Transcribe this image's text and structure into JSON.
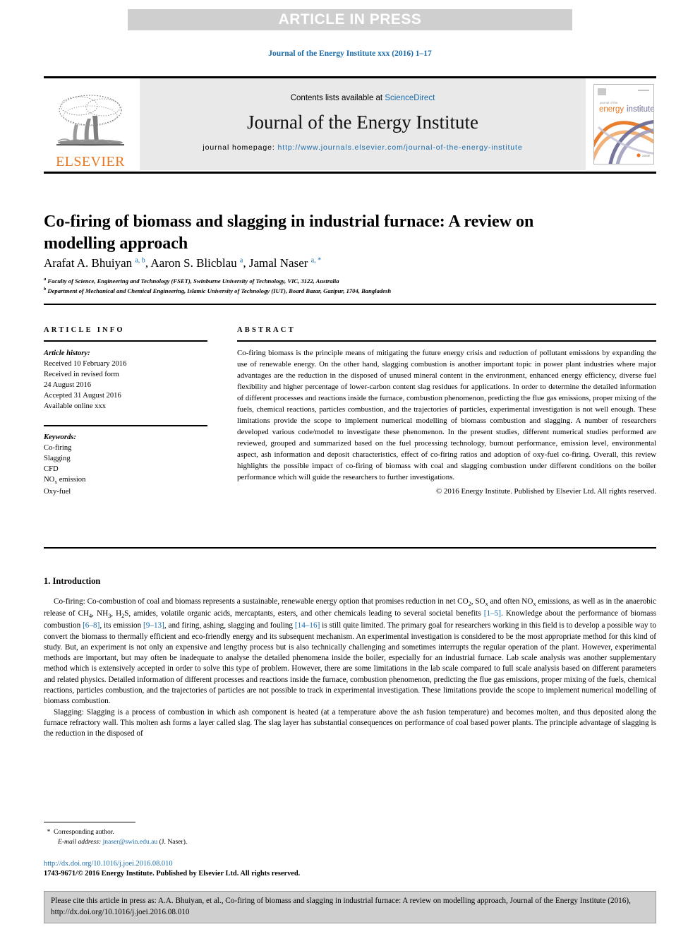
{
  "banner": {
    "label": "ARTICLE IN PRESS"
  },
  "running_head": {
    "text": "Journal of the Energy Institute xxx (2016) 1–17"
  },
  "masthead": {
    "contents_prefix": "Contents lists available at ",
    "sciencedirect": "ScienceDirect",
    "journal_title": "Journal of the Energy Institute",
    "homepage_label": "journal homepage: ",
    "homepage_url": "http://www.journals.elsevier.com/journal-of-the-energy-institute",
    "publisher_name": "ELSEVIER",
    "cover_title_small": "journal of the",
    "cover_title_main_a": "energy",
    "cover_title_main_b": "institute"
  },
  "article": {
    "title": "Co-firing of biomass and slagging in industrial furnace: A review on modelling approach",
    "authors_html": "Arafat A. Bhuiyan <sup>a, b</sup>, Aaron S. Blicblau <sup>a</sup>, Jamal Naser <sup>a, *</sup>",
    "affiliation_a": "Faculty of Science, Engineering and Technology (FSET), Swinburne University of Technology, VIC, 3122, Australia",
    "affiliation_b": "Department of Mechanical and Chemical Engineering, Islamic University of Technology (IUT), Board Bazar, Gazipur, 1704, Bangladesh"
  },
  "article_info": {
    "heading": "ARTICLE INFO",
    "history_label": "Article history:",
    "history_lines": [
      "Received 10 February 2016",
      "Received in revised form",
      "24 August 2016",
      "Accepted 31 August 2016",
      "Available online xxx"
    ],
    "keywords_label": "Keywords:",
    "keywords": [
      "Co-firing",
      "Slagging",
      "CFD",
      "NOx emission",
      "Oxy-fuel"
    ],
    "keyword_nox_base": "NO",
    "keyword_nox_sub": "x",
    "keyword_nox_rest": " emission"
  },
  "abstract": {
    "heading": "ABSTRACT",
    "text": "Co-firing biomass is the principle means of mitigating the future energy crisis and reduction of pollutant emissions by expanding the use of renewable energy. On the other hand, slagging combustion is another important topic in power plant industries where major advantages are the reduction in the disposed of unused mineral content in the environment, enhanced energy efficiency, diverse fuel flexibility and higher percentage of lower-carbon content slag residues for applications. In order to determine the detailed information of different processes and reactions inside the furnace, combustion phenomenon, predicting the flue gas emissions, proper mixing of the fuels, chemical reactions, particles combustion, and the trajectories of particles, experimental investigation is not well enough. These limitations provide the scope to implement numerical modelling of biomass combustion and slagging. A number of researchers developed various code/model to investigate these phenomenon. In the present studies, different numerical studies performed are reviewed, grouped and summarized based on the fuel processing technology, burnout performance, emission level, environmental aspect, ash information and deposit characteristics, effect of co-firing ratios and adoption of oxy-fuel co-firing. Overall, this review highlights the possible impact of co-firing of biomass with coal and slagging combustion under different conditions on the boiler performance which will guide the researchers to further investigations.",
    "copyright": "© 2016 Energy Institute. Published by Elsevier Ltd. All rights reserved."
  },
  "introduction": {
    "heading": "1. Introduction",
    "paragraph_1_parts": [
      {
        "type": "text",
        "value": "Co-firing: Co-combustion of coal and biomass represents a sustainable, renewable energy option that promises reduction in net CO"
      },
      {
        "type": "sub",
        "value": "2"
      },
      {
        "type": "text",
        "value": ", SO"
      },
      {
        "type": "sub",
        "value": "x"
      },
      {
        "type": "text",
        "value": " and often NO"
      },
      {
        "type": "sub",
        "value": "x"
      },
      {
        "type": "text",
        "value": " emissions, as well as in the anaerobic release of CH"
      },
      {
        "type": "sub",
        "value": "4"
      },
      {
        "type": "text",
        "value": ", NH"
      },
      {
        "type": "sub",
        "value": "3"
      },
      {
        "type": "text",
        "value": ", H"
      },
      {
        "type": "sub",
        "value": "2"
      },
      {
        "type": "text",
        "value": "S, amides, volatile organic acids, mercaptants, esters, and other chemicals leading to several societal benefits "
      },
      {
        "type": "ref",
        "value": "[1–5]"
      },
      {
        "type": "text",
        "value": ". Knowledge about the performance of biomass combustion "
      },
      {
        "type": "ref",
        "value": "[6–8]"
      },
      {
        "type": "text",
        "value": ", its emission "
      },
      {
        "type": "ref",
        "value": "[9–13]"
      },
      {
        "type": "text",
        "value": ", and firing, ashing, slagging and fouling "
      },
      {
        "type": "ref",
        "value": "[14–16]"
      },
      {
        "type": "text",
        "value": " is still quite limited. The primary goal for researchers working in this field is to develop a possible way to convert the biomass to thermally efficient and eco-friendly energy and its subsequent mechanism. An experimental investigation is considered to be the most appropriate method for this kind of study. But, an experiment is not only an expensive and lengthy process but is also technically challenging and sometimes interrupts the regular operation of the plant. However, experimental methods are important, but may often be inadequate to analyse the detailed phenomena inside the boiler, especially for an industrial furnace. Lab scale analysis was another supplementary method which is extensively accepted in order to solve this type of problem. However, there are some limitations in the lab scale compared to full scale analysis based on different parameters and related physics. Detailed information of different processes and reactions inside the furnace, combustion phenomenon, predicting the flue gas emissions, proper mixing of the fuels, chemical reactions, particles combustion, and the trajectories of particles are not possible to track in experimental investigation. These limitations provide the scope to implement numerical modelling of biomass combustion."
      }
    ],
    "paragraph_2": "Slagging: Slagging is a process of combustion in which ash component is heated (at a temperature above the ash fusion temperature) and becomes molten, and thus deposited along the furnace refractory wall. This molten ash forms a layer called slag. The slag layer has substantial consequences on performance of coal based power plants. The principle advantage of slagging is the reduction in the disposed of"
  },
  "footer": {
    "corresponding_star": "*",
    "corresponding_label": "Corresponding author.",
    "email_label": "E-mail address:",
    "email_address": "jnaser@swin.edu.au",
    "email_person": "(J. Naser).",
    "doi_url": "http://dx.doi.org/10.1016/j.joei.2016.08.010",
    "issn_line": "1743-9671/© 2016 Energy Institute. Published by Elsevier Ltd. All rights reserved."
  },
  "cite_box": {
    "text": "Please cite this article in press as: A.A. Bhuiyan, et al., Co-firing of biomass and slagging in industrial furnace: A review on modelling approach, Journal of the Energy Institute (2016), http://dx.doi.org/10.1016/j.joei.2016.08.010"
  },
  "colors": {
    "link": "#1a6ba8",
    "elsevier_orange": "#e87722",
    "banner_gray": "#cfcfcf",
    "masthead_gray": "#e9e9e9"
  }
}
